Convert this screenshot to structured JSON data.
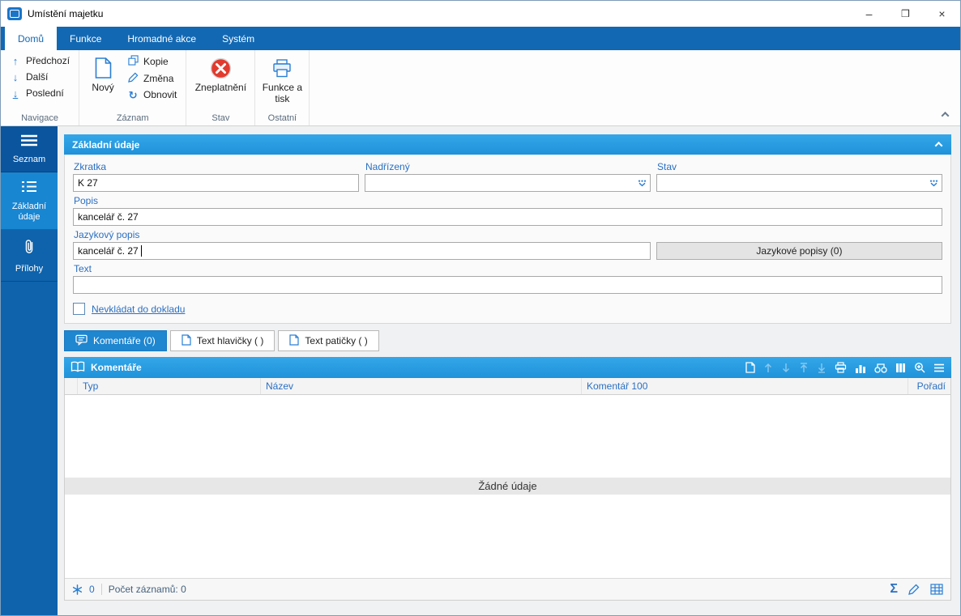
{
  "window": {
    "title": "Umístění majetku",
    "controls": {
      "minimize": "–",
      "maximize": "❒",
      "close": "×"
    }
  },
  "icons": {
    "arrow_up": "↑",
    "arrow_down": "↓",
    "arrow_last": "↓",
    "refresh": "↻",
    "sum": "Σ"
  },
  "ribbon": {
    "tabs": [
      {
        "label": "Domů",
        "active": true
      },
      {
        "label": "Funkce",
        "active": false
      },
      {
        "label": "Hromadné akce",
        "active": false
      },
      {
        "label": "Systém",
        "active": false
      }
    ],
    "nav": {
      "label": "Navigace",
      "prev": "Předchozí",
      "next": "Další",
      "last": "Poslední"
    },
    "record": {
      "label": "Záznam",
      "new": "Nový",
      "copy": "Kopie",
      "change": "Změna",
      "refresh": "Obnovit"
    },
    "state": {
      "label": "Stav",
      "invalidate": "Zneplatnění"
    },
    "other": {
      "label": "Ostatní",
      "func_print": "Funkce a tisk"
    }
  },
  "sidebar": {
    "items": [
      {
        "label": "Seznam"
      },
      {
        "label": "Základní údaje",
        "active": true
      },
      {
        "label": "Přílohy"
      }
    ]
  },
  "form": {
    "title": "Základní údaje",
    "zkratka": {
      "label": "Zkratka",
      "value": "K 27"
    },
    "nadrizeny": {
      "label": "Nadřízený",
      "value": ""
    },
    "stav": {
      "label": "Stav",
      "value": ""
    },
    "popis": {
      "label": "Popis",
      "value": "kancelář č. 27"
    },
    "jazykovy": {
      "label": "Jazykový popis",
      "value": "kancelář č. 27"
    },
    "jazykove_btn": "Jazykové popisy (0)",
    "text": {
      "label": "Text",
      "value": ""
    },
    "checkbox_label": "Nevkládat do dokladu",
    "checkbox_checked": false
  },
  "tabs": [
    {
      "label": "Komentáře (0)",
      "active": true
    },
    {
      "label": "Text hlavičky ( )",
      "active": false
    },
    {
      "label": "Text patičky ( )",
      "active": false
    }
  ],
  "grid": {
    "title": "Komentáře",
    "columns": [
      "Typ",
      "Název",
      "Komentář 100",
      "Pořadí"
    ],
    "rows": [],
    "empty": "Žádné údaje",
    "footer": {
      "marked": "0",
      "records": "Počet záznamů: 0"
    }
  }
}
